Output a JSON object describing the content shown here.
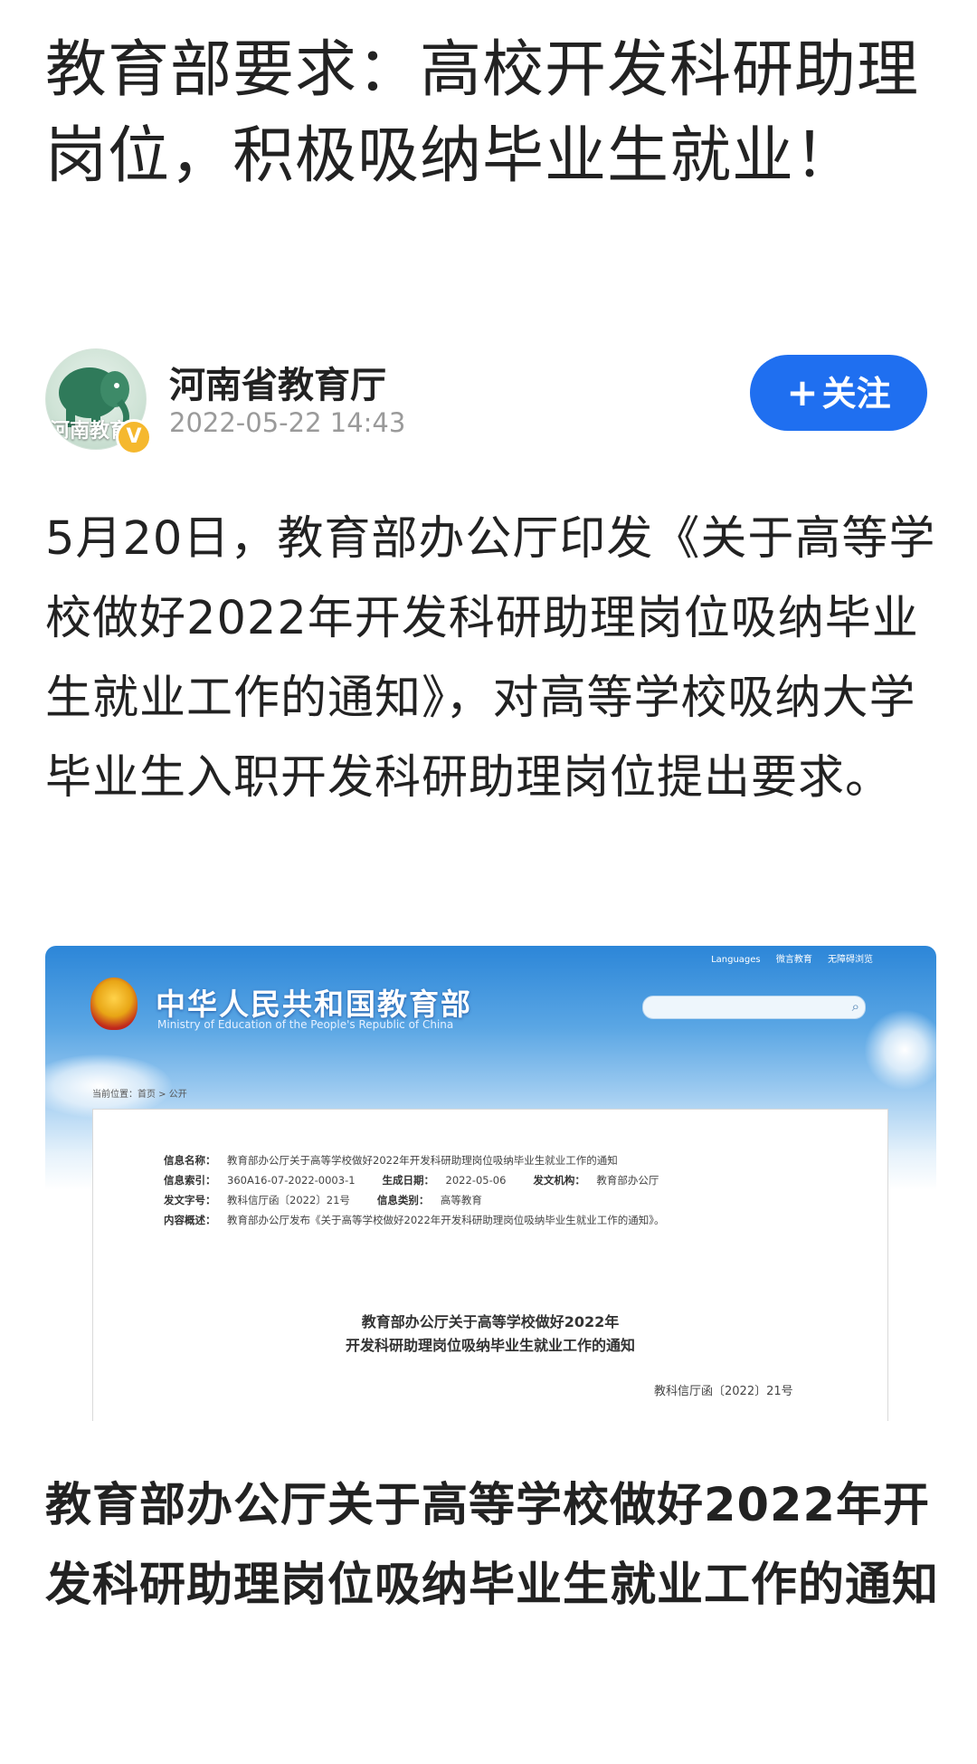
{
  "article": {
    "title": "教育部要求：高校开发科研助理岗位，积极吸纳毕业生就业！",
    "body": "5月20日，教育部办公厅印发《关于高等学校做好2022年开发科研助理岗位吸纳毕业生就业工作的通知》，对高等学校吸纳大学毕业生入职开发科研助理岗位提出要求。",
    "caption": "教育部办公厅关于高等学校做好2022年开发科研助理岗位吸纳毕业生就业工作的通知"
  },
  "author": {
    "name": "河南省教育厅",
    "time": "2022-05-22 14:43",
    "avatar_text": "河南教育",
    "verified_mark": "V",
    "follow_plus": "+",
    "follow_label": "关注"
  },
  "embedded_image": {
    "site_title": "中华人民共和国教育部",
    "site_subtitle": "Ministry of Education of the People's Republic of China",
    "top_links": "Languages  微言教育  无障碍浏览",
    "breadcrumb": "当前位置：首页 > 公开",
    "info": {
      "name_label": "信息名称：",
      "name_value": "教育部办公厅关于高等学校做好2022年开发科研助理岗位吸纳毕业生就业工作的通知",
      "index_label": "信息索引：",
      "index_value": "360A16-07-2022-0003-1",
      "date_label": "生成日期：",
      "date_value": "2022-05-06",
      "org_label": "发文机构：",
      "org_value": "教育部办公厅",
      "docno_label": "发文字号：",
      "docno_value": "教科信厅函〔2022〕21号",
      "category_label": "信息类别：",
      "category_value": "高等教育",
      "summary_label": "内容概述：",
      "summary_value": "教育部办公厅发布《关于高等学校做好2022年开发科研助理岗位吸纳毕业生就业工作的通知》。"
    },
    "doc_title_line1": "教育部办公厅关于高等学校做好2022年",
    "doc_title_line2": "开发科研助理岗位吸纳毕业生就业工作的通知",
    "doc_number": "教科信厅函〔2022〕21号"
  },
  "colors": {
    "follow_button": "#1f6ff0",
    "verified_badge": "#f5b82e",
    "timestamp": "#9a9a9a"
  }
}
